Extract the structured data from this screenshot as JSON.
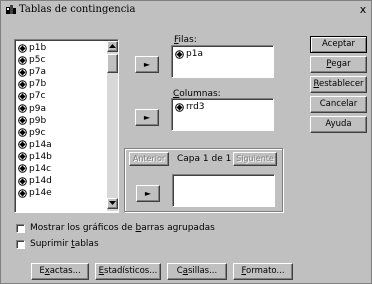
{
  "window": {
    "title": "Tablas de contingencia",
    "close_label": "x"
  },
  "variables": {
    "items": [
      "p1b",
      "p5c",
      "p7a",
      "p7b",
      "p7c",
      "p9a",
      "p9b",
      "p9c",
      "p14a",
      "p14b",
      "p14c",
      "p14d",
      "p14e"
    ]
  },
  "rows": {
    "label_prefix": "",
    "label_underlined": "F",
    "label_rest": "ilas:",
    "items": [
      "p1a"
    ]
  },
  "columns": {
    "label_underlined": "C",
    "label_rest": "olumnas:",
    "items": [
      "rrd3"
    ]
  },
  "layer": {
    "previous_label": "Anterior",
    "layer_text": "Capa 1 de 1",
    "next_label": "Siguiente"
  },
  "move_arrow": "►",
  "buttons": {
    "accept": "Aceptar",
    "paste_u": "P",
    "paste_rest": "egar",
    "reset_u": "R",
    "reset_rest": "establecer",
    "cancel": "Cancelar",
    "help": "Ayuda"
  },
  "options": {
    "clustered_bars_pre": "Mostrar los gráficos de ",
    "clustered_bars_u": "b",
    "clustered_bars_post": "arras agrupadas",
    "clustered_bars_checked": false,
    "suppress_tables_pre": "Suprimir ",
    "suppress_tables_u": "t",
    "suppress_tables_post": "ablas",
    "suppress_tables_checked": false
  },
  "bottom_buttons": {
    "exact_pre": "E",
    "exact_u": "x",
    "exact_post": "actas...",
    "statistics_u": "E",
    "statistics_post": "stadísticos...",
    "cells_pre": "C",
    "cells_u": "a",
    "cells_post": "sillas...",
    "format_u": "F",
    "format_post": "ormato..."
  }
}
